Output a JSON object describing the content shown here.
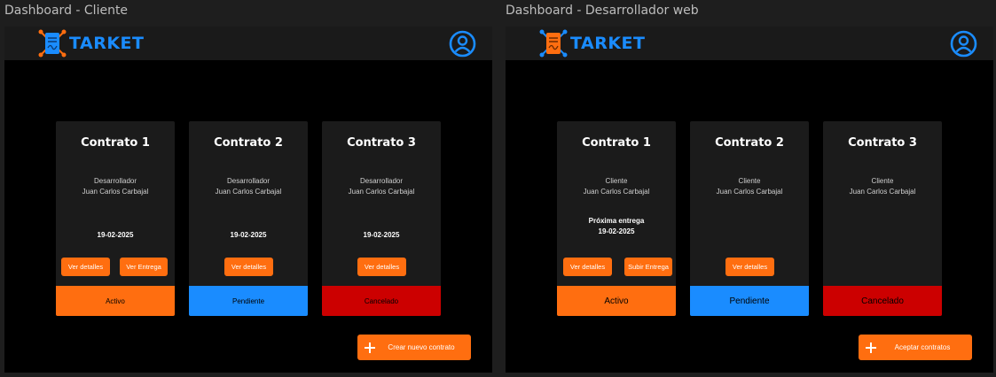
{
  "frames": [
    {
      "label": "Dashboard - Cliente",
      "brand": "TARKET",
      "cards": [
        {
          "title": "Contrato 1",
          "role": "Desarrollador",
          "name": "Juan Carlos Carbajal",
          "next": "",
          "date": "19-02-2025",
          "buttons": [
            "Ver detalles",
            "Ver Entrega"
          ],
          "status": "Activo"
        },
        {
          "title": "Contrato 2",
          "role": "Desarrollador",
          "name": "Juan Carlos Carbajal",
          "next": "",
          "date": "19-02-2025",
          "buttons": [
            "Ver detalles"
          ],
          "status": "Pendiente"
        },
        {
          "title": "Contrato 3",
          "role": "Desarrollador",
          "name": "Juan Carlos Carbajal",
          "next": "",
          "date": "19-02-2025",
          "buttons": [
            "Ver detalles"
          ],
          "status": "Cancelado"
        }
      ],
      "action": "Crear nuevo contrato"
    },
    {
      "label": "Dashboard - Desarrollador web",
      "brand": "TARKET",
      "cards": [
        {
          "title": "Contrato 1",
          "role": "Cliente",
          "name": "Juan Carlos Carbajal",
          "next": "Próxima entrega",
          "date": "19-02-2025",
          "buttons": [
            "Ver detalles",
            "Subir Entrega"
          ],
          "status": "Activo"
        },
        {
          "title": "Contrato 2",
          "role": "Cliente",
          "name": "Juan Carlos Carbajal",
          "next": "",
          "date": "",
          "buttons": [
            "Ver detalles"
          ],
          "status": "Pendiente"
        },
        {
          "title": "Contrato 3",
          "role": "Cliente",
          "name": "Juan Carlos Carbajal",
          "next": "",
          "date": "",
          "buttons": [],
          "status": "Cancelado"
        }
      ],
      "action": "Aceptar contratos"
    }
  ],
  "colors": {
    "accent": "#ff6e10",
    "brand_blue": "#1a8cff",
    "cancel_red": "#cc0000",
    "card_bg": "#1b1b1b"
  },
  "icons": {
    "logo": "document-logo-icon",
    "profile": "user-profile-icon",
    "add": "plus-icon"
  }
}
